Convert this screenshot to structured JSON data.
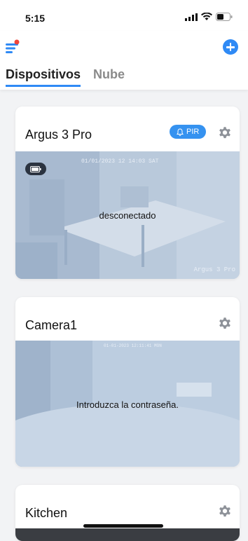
{
  "status_bar": {
    "time": "5:15"
  },
  "header": {
    "menu_icon": "menu-icon",
    "add_icon": "plus-circle-icon",
    "tabs": [
      {
        "label": "Dispositivos",
        "active": true
      },
      {
        "label": "Nube",
        "active": false
      }
    ]
  },
  "devices": [
    {
      "name": "Argus 3 Pro",
      "badge": "PIR",
      "badge_icon": "bell-icon",
      "status_message": "desconectado",
      "overlay_timestamp": "01/01/2023 12 14:03 SAT",
      "overlay_watermark": "Argus 3 Pro",
      "battery_icon": "battery-icon"
    },
    {
      "name": "Camera1",
      "status_message": "Introduzca la contraseña.",
      "overlay_timestamp": "01-01-2023 12:11:41 MON"
    },
    {
      "name": "Kitchen"
    }
  ],
  "colors": {
    "accent": "#2f8af5",
    "badge": "#3592f0",
    "background": "#f2f3f5"
  }
}
